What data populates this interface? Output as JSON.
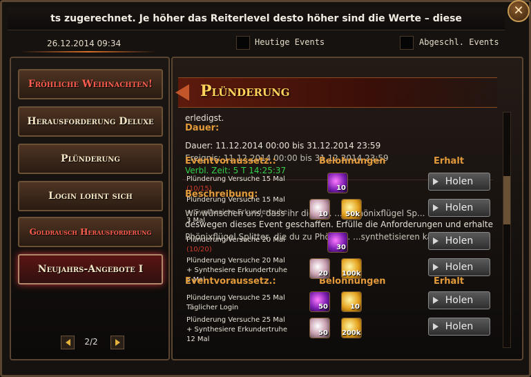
{
  "ticker": "ts zugerechnet. Je höher das Reiterlevel desto höher sind die Werte – diese",
  "close_label": "✕",
  "topbar": {
    "datetime": "26.12.2014 09:34",
    "today_events": "Heutige Events",
    "finished_events": "Abgeschl. Events"
  },
  "sidebar": {
    "items": [
      {
        "label": "Fröhliche Weihnachten!"
      },
      {
        "label": "Herausforderung Deluxe"
      },
      {
        "label": "Plünderung"
      },
      {
        "label": "Login lohnt sich"
      },
      {
        "label": "Goldrausch Herausforderung"
      },
      {
        "label": "Neujahrs-Angebote I"
      }
    ],
    "page": "2/2"
  },
  "content": {
    "title": "Plünderung",
    "text_erledigt": "erledigst.",
    "dauer_heading": "Dauer:",
    "dauer_value": "Dauer: 11.12.2014 00:00 bis 31.12.2014 23:59",
    "ereignis_value": "Ereignis: 11.12.2014 00:00 bis 31.12.2014 23:59",
    "col_requirements": "Eventvoraussetz.:",
    "col_rewards": "Belohnungen",
    "col_received": "Erhalt",
    "remaining": "Verbl. Zeit: 5 T  14:25:37",
    "beschreibung": "Beschreibung:",
    "desc1": "Wir wünschen uns, dass ihr die Pr... ...m Phönixflügel Sp...",
    "desc2": "deswegen dieses Event geschaffen. Erfülle die Anforderungen und erhalte",
    "desc3": "Phönixflügel Splitter, die du zu Phönix... ...synthetisieren kannst.",
    "rows": [
      {
        "line1": "Plünderung Versuche 15 Mal",
        "line2": "(10/15)",
        "icons": [
          {
            "type": "orb",
            "count": "10"
          }
        ],
        "button": "Holen"
      },
      {
        "line1": "Plünderung Versuche 15 Mal",
        "line2": "+ Synthesiere Erkundertruhe",
        "line3": "3 Mal",
        "icons": [
          {
            "type": "pearl",
            "count": "10"
          },
          {
            "type": "coin",
            "count": "50k"
          }
        ],
        "button": "Holen"
      },
      {
        "line1": "Plünderung Versuche 20 Mal",
        "line2": "(10/20)",
        "icons": [
          {
            "type": "orb",
            "count": "30"
          }
        ],
        "button": "Holen"
      },
      {
        "line1": "Plünderung Versuche 20 Mal",
        "line2": "+ Synthesiere Erkundertruhe",
        "line3": "5 Mal",
        "icons": [
          {
            "type": "pearl",
            "count": "20"
          },
          {
            "type": "coin",
            "count": "100k"
          }
        ],
        "button": "Holen"
      },
      {
        "line1": "Plünderung Versuche 25 Mal",
        "line2": "Täglicher Login",
        "icons": [
          {
            "type": "orb",
            "count": "50"
          },
          {
            "type": "coin",
            "count": "10"
          }
        ],
        "button": "Holen"
      },
      {
        "line1": "Plünderung Versuche 25 Mal",
        "line2": "+ Synthesiere Erkundertruhe",
        "line3": "12 Mal",
        "icons": [
          {
            "type": "pearl",
            "count": "50"
          },
          {
            "type": "coin",
            "count": "200k"
          }
        ],
        "button": "Holen"
      }
    ],
    "eventvorausz_2": "Eventvoraussetz.:",
    "belohnungen_2": "Belohnungen",
    "erhalt_2": "Erhalt"
  }
}
